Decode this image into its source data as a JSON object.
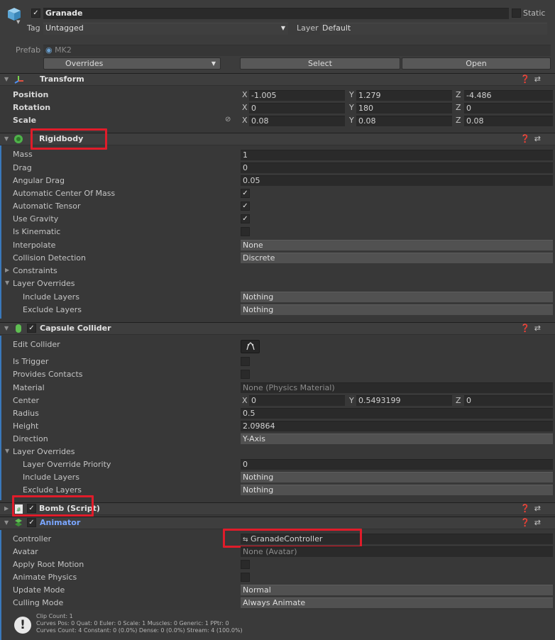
{
  "header": {
    "object_name": "Granade",
    "static_label": "Static",
    "tag_label": "Tag",
    "tag_value": "Untagged",
    "layer_label": "Layer",
    "layer_value": "Default",
    "prefab_label": "Prefab",
    "prefab_value": "MK2",
    "overrides_value": "Overrides",
    "select_button": "Select",
    "open_button": "Open"
  },
  "transform": {
    "title": "Transform",
    "position_label": "Position",
    "rotation_label": "Rotation",
    "scale_label": "Scale",
    "position": {
      "x": "-1.005",
      "y": "1.279",
      "z": "-4.486"
    },
    "rotation": {
      "x": "0",
      "y": "180",
      "z": "0"
    },
    "scale": {
      "x": "0.08",
      "y": "0.08",
      "z": "0.08"
    },
    "axis_x": "X",
    "axis_y": "Y",
    "axis_z": "Z"
  },
  "rigidbody": {
    "title": "Rigidbody",
    "mass_label": "Mass",
    "mass": "1",
    "drag_label": "Drag",
    "drag": "0",
    "angular_drag_label": "Angular Drag",
    "angular_drag": "0.05",
    "auto_com_label": "Automatic Center Of Mass",
    "auto_tensor_label": "Automatic Tensor",
    "use_gravity_label": "Use Gravity",
    "is_kinematic_label": "Is Kinematic",
    "interpolate_label": "Interpolate",
    "interpolate": "None",
    "collision_label": "Collision Detection",
    "collision": "Discrete",
    "constraints_label": "Constraints",
    "layer_overrides_label": "Layer Overrides",
    "include_layers_label": "Include Layers",
    "include_layers": "Nothing",
    "exclude_layers_label": "Exclude Layers",
    "exclude_layers": "Nothing"
  },
  "capsule": {
    "title": "Capsule Collider",
    "edit_collider_label": "Edit Collider",
    "is_trigger_label": "Is Trigger",
    "provides_contacts_label": "Provides Contacts",
    "material_label": "Material",
    "material": "None (Physics Material)",
    "center_label": "Center",
    "center": {
      "x": "0",
      "y": "0.5493199",
      "z": "0"
    },
    "radius_label": "Radius",
    "radius": "0.5",
    "height_label": "Height",
    "height": "2.09864",
    "direction_label": "Direction",
    "direction": "Y-Axis",
    "layer_overrides_label": "Layer Overrides",
    "priority_label": "Layer Override Priority",
    "priority": "0",
    "include_layers_label": "Include Layers",
    "include_layers": "Nothing",
    "exclude_layers_label": "Exclude Layers",
    "exclude_layers": "Nothing"
  },
  "bomb": {
    "title": "Bomb (Script)"
  },
  "animator": {
    "title": "Animator",
    "controller_label": "Controller",
    "controller": "GranadeController",
    "avatar_label": "Avatar",
    "avatar": "None (Avatar)",
    "root_motion_label": "Apply Root Motion",
    "animate_physics_label": "Animate Physics",
    "update_mode_label": "Update Mode",
    "update_mode": "Normal",
    "culling_mode_label": "Culling Mode",
    "culling_mode": "Always Animate",
    "info_line1": "Clip Count: 1",
    "info_line2": "Curves Pos: 0 Quat: 0 Euler: 0 Scale: 1 Muscles: 0 Generic: 1 PPtr: 0",
    "info_line3": "Curves Count: 4 Constant: 0 (0.0%) Dense: 0 (0.0%) Stream: 4 (100.0%)"
  },
  "colors": {
    "highlight_box": "#e01c2a",
    "accent_blue": "#3a79bb",
    "animator_title": "#7aa6ff"
  }
}
